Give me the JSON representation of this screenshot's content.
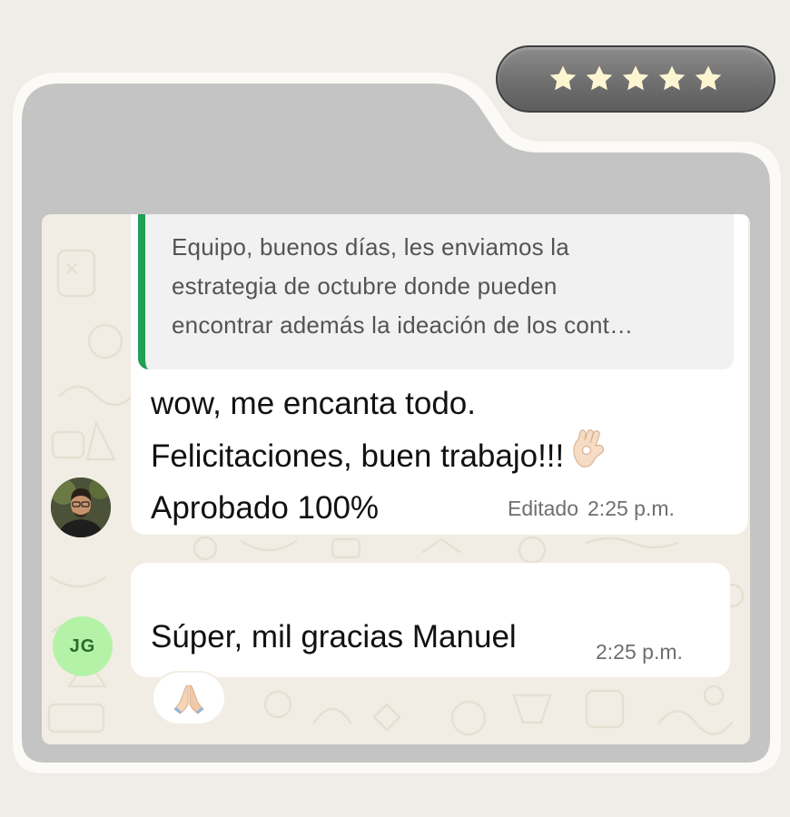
{
  "rating": {
    "stars": 5,
    "max": 5,
    "star_color": "#fdf5d2"
  },
  "colors": {
    "page_bg": "#efede8",
    "folder_bg": "#c4c4c4",
    "chat_bg": "#f2ede4",
    "quote_accent": "#21a056",
    "avatar_jg_bg": "#b4f2a8"
  },
  "chat": {
    "messages": [
      {
        "quoted_lines": [
          "Equipo, buenos días, les enviamos la",
          "estrategia de octubre donde pueden",
          "encontrar además la ideación de los cont…"
        ],
        "lines": [
          "wow, me encanta todo.",
          "Felicitaciones, buen trabajo!!!",
          "Aprobado 100%"
        ],
        "emoji": "ok-hand",
        "edited_label": "Editado",
        "time": "2:25 p.m.",
        "avatar": "profile-photo"
      },
      {
        "text": "Súper, mil gracias Manuel",
        "time": "2:25 p.m.",
        "avatar_initials": "JG",
        "reaction": "folded-hands"
      }
    ]
  }
}
